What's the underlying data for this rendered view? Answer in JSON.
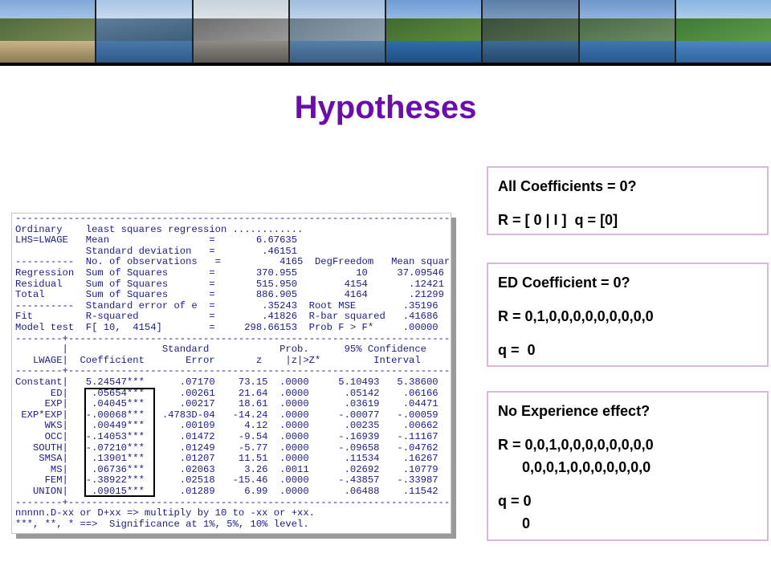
{
  "banner": {
    "photos": [
      "lake-town-photo",
      "mountain-lake-photo",
      "lakeside-promenade-photo",
      "hillside-lake-photo",
      "lake-shore-photo",
      "mountain-peak-lake-photo",
      "harbor-photo",
      "lakeside-bench-photo"
    ]
  },
  "slide": {
    "title": "Hypotheses"
  },
  "regression": {
    "lines": [
      "--------------------------------------------------------------------------",
      "Ordinary    least squares regression ............",
      "LHS=LWAGE   Mean                 =       6.67635",
      "            Standard deviation   =        .46151",
      "----------  No. of observations   =          4165  DegFreedom   Mean square",
      "Regression  Sum of Squares       =       370.955          10     37.09546",
      "Residual    Sum of Squares       =       515.950        4154       .12421",
      "Total       Sum of Squares       =       886.905        4164       .21299",
      "----------  Standard error of e  =        .35243  Root MSE        .35196",
      "Fit         R-squared            =        .41826  R-bar squared   .41686",
      "Model test  F[ 10,  4154]        =     298.66153  Prob F > F*     .00000",
      "--------+------------------------------------------------------------------",
      "        |                Standard            Prob.      95% Confidence",
      "   LWAGE|  Coefficient       Error       z    |z|>Z*         Interval",
      "--------+------------------------------------------------------------------",
      "Constant|   5.24547***      .07170    73.15  .0000     5.10493   5.38600",
      "      ED|    .05654***      .00261    21.64  .0000      .05142    .06166",
      "     EXP|    .04045***      .00217    18.61  .0000      .03619    .04471",
      " EXP*EXP|   -.00068***   .4783D-04   -14.24  .0000     -.00077   -.00059",
      "     WKS|    .00449***      .00109     4.12  .0000      .00235    .00662",
      "     OCC|   -.14053***      .01472    -9.54  .0000     -.16939   -.11167",
      "   SOUTH|   -.07210***      .01249    -5.77  .0000     -.09658   -.04762",
      "    SMSA|    .13901***      .01207    11.51  .0000      .11534    .16267",
      "      MS|    .06736***      .02063     3.26  .0011      .02692    .10779",
      "     FEM|   -.38922***      .02518   -15.46  .0000     -.43857   -.33987",
      "   UNION|    .09015***      .01289     6.99  .0000      .06488    .11542",
      "--------+------------------------------------------------------------------",
      "nnnnn.D-xx or D+xx => multiply by 10 to -xx or +xx.",
      "***, **, * ==>  Significance at 1%, 5%, 10% level.",
      "--------------------------------------------------------------------------"
    ]
  },
  "hypotheses": [
    {
      "lines": [
        "All Coefficients = 0?",
        "R = [ 0 | I ]  q = [0]"
      ]
    },
    {
      "lines": [
        "ED Coefficient = 0?",
        "R = 0,1,0,0,0,0,0,0,0,0,0",
        "q =  0"
      ]
    },
    {
      "lines": [
        "No Experience effect?",
        "R = 0,0,1,0,0,0,0,0,0,0,0",
        "      0,0,0,1,0,0,0,0,0,0,0",
        "q = 0",
        "      0"
      ]
    }
  ]
}
